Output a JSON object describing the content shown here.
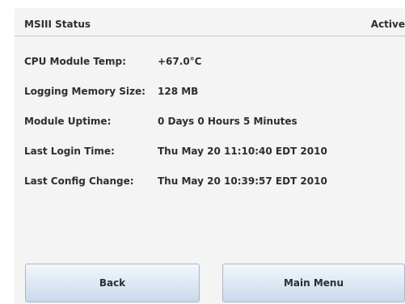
{
  "header": {
    "title": "MSIII Status",
    "state": "Active"
  },
  "status": {
    "rows": [
      {
        "label": "CPU Module Temp:",
        "value": "+67.0°C"
      },
      {
        "label": "Logging Memory Size:",
        "value": "128 MB"
      },
      {
        "label": "Module Uptime:",
        "value": "0 Days 0 Hours 5 Minutes"
      },
      {
        "label": "Last Login Time:",
        "value": "Thu May 20 11:10:40 EDT 2010"
      },
      {
        "label": "Last Config Change:",
        "value": "Thu May 20 10:39:57 EDT 2010"
      }
    ]
  },
  "buttons": {
    "back_label": "Back",
    "main_menu_label": "Main Menu"
  }
}
